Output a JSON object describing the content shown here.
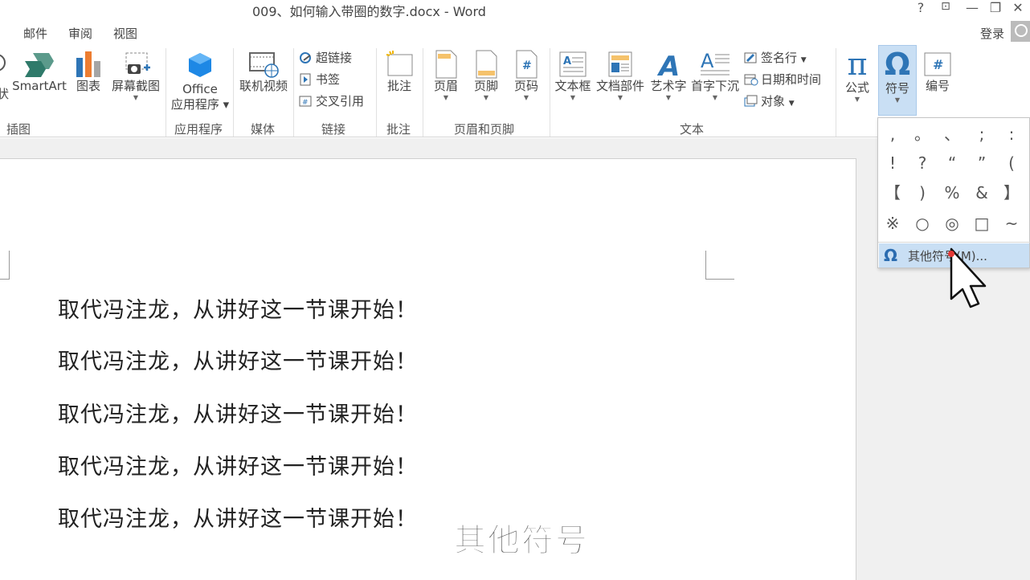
{
  "window": {
    "title": "009、如何输入带圈的数字.docx - Word",
    "help": "?",
    "restore_ribbon": "⊡",
    "minimize": "—",
    "maximize": "❐",
    "close": "✕"
  },
  "menu": {
    "tabs": [
      "邮件",
      "审阅",
      "视图"
    ],
    "login": "登录"
  },
  "ribbon": {
    "groups": {
      "illustrations": "插图",
      "apps": "应用程序",
      "media": "媒体",
      "links": "链接",
      "comments": "批注",
      "header_footer": "页眉和页脚",
      "text": "文本"
    },
    "buttons": {
      "smartart": "SmartArt",
      "chart": "图表",
      "screenshot": "屏幕截图",
      "office_apps_1": "Office",
      "office_apps_2": "应用程序",
      "online_video": "联机视频",
      "hyperlink": "超链接",
      "bookmark": "书签",
      "cross_ref": "交叉引用",
      "comment": "批注",
      "header": "页眉",
      "footer": "页脚",
      "page_number": "页码",
      "text_box": "文本框",
      "quick_parts": "文档部件",
      "wordart": "艺术字",
      "drop_cap": "首字下沉",
      "signature_line": "签名行",
      "date_time": "日期和时间",
      "object": "对象",
      "equation": "公式",
      "symbol": "符号",
      "number": "编号"
    },
    "icons": {
      "equation_glyph": "π",
      "symbol_glyph": "Ω",
      "number_glyph": "#",
      "wordart_glyph": "A",
      "drop_cap_glyph": "A"
    }
  },
  "document": {
    "lines": [
      "取代冯注龙，从讲好这一节课开始！",
      "取代冯注龙，从讲好这一节课开始！",
      "取代冯注龙，从讲好这一节课开始！",
      "取代冯注龙，从讲好这一节课开始！",
      "取代冯注龙，从讲好这一节课开始！"
    ]
  },
  "symbols_dropdown": {
    "symbols": [
      [
        ",",
        "。",
        "、",
        ";",
        ":"
      ],
      [
        "!",
        "?",
        "“",
        "”",
        "("
      ],
      [
        "【",
        ")",
        "%",
        "&",
        "】"
      ],
      [
        "※",
        "○",
        "◎",
        "□",
        "~"
      ]
    ],
    "more_symbols": "其他符号(M)...",
    "more_symbols_icon": "Ω"
  },
  "subtitle": "其他符号",
  "colors": {
    "accent_blue": "#2b6cb0",
    "selected_bg": "#c9dff4"
  }
}
